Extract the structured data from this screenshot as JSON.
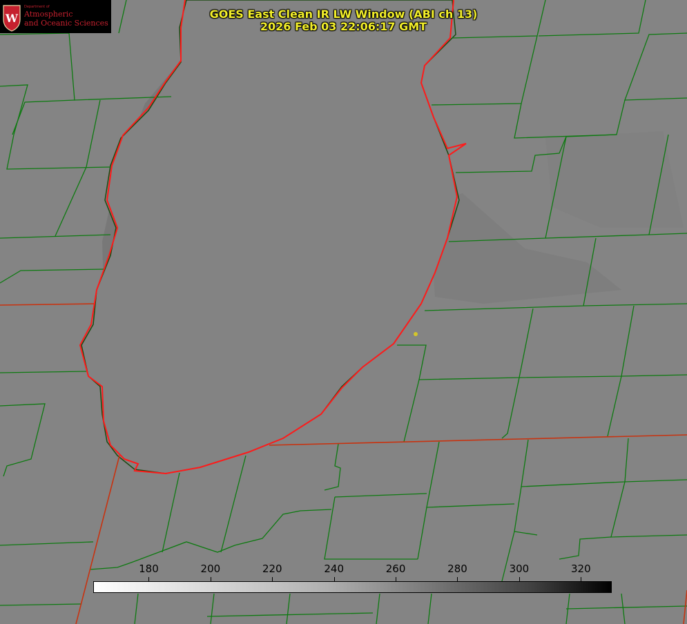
{
  "title": {
    "line1": "GOES East Clean IR LW Window (ABI ch 13)",
    "line2": "2026 Feb 03 22:06:17 GMT"
  },
  "logo": {
    "department": "Department of",
    "line1": "Atmospheric",
    "line2": "and Oceanic Sciences",
    "shield_letter": "W"
  },
  "colorbar": {
    "range": [
      162,
      330
    ],
    "colormap": "grayscale inverted (white = cold, black = warm)",
    "ticks": [
      "180",
      "200",
      "220",
      "240",
      "260",
      "280",
      "300",
      "320"
    ]
  },
  "colors": {
    "background": "#848484",
    "county_lines": "#0d7a10",
    "state_borders": "#d03010",
    "lake_shoreline": "#ff1a1a",
    "title_text": "#f2ee2a",
    "marker": "#d4c62a"
  }
}
